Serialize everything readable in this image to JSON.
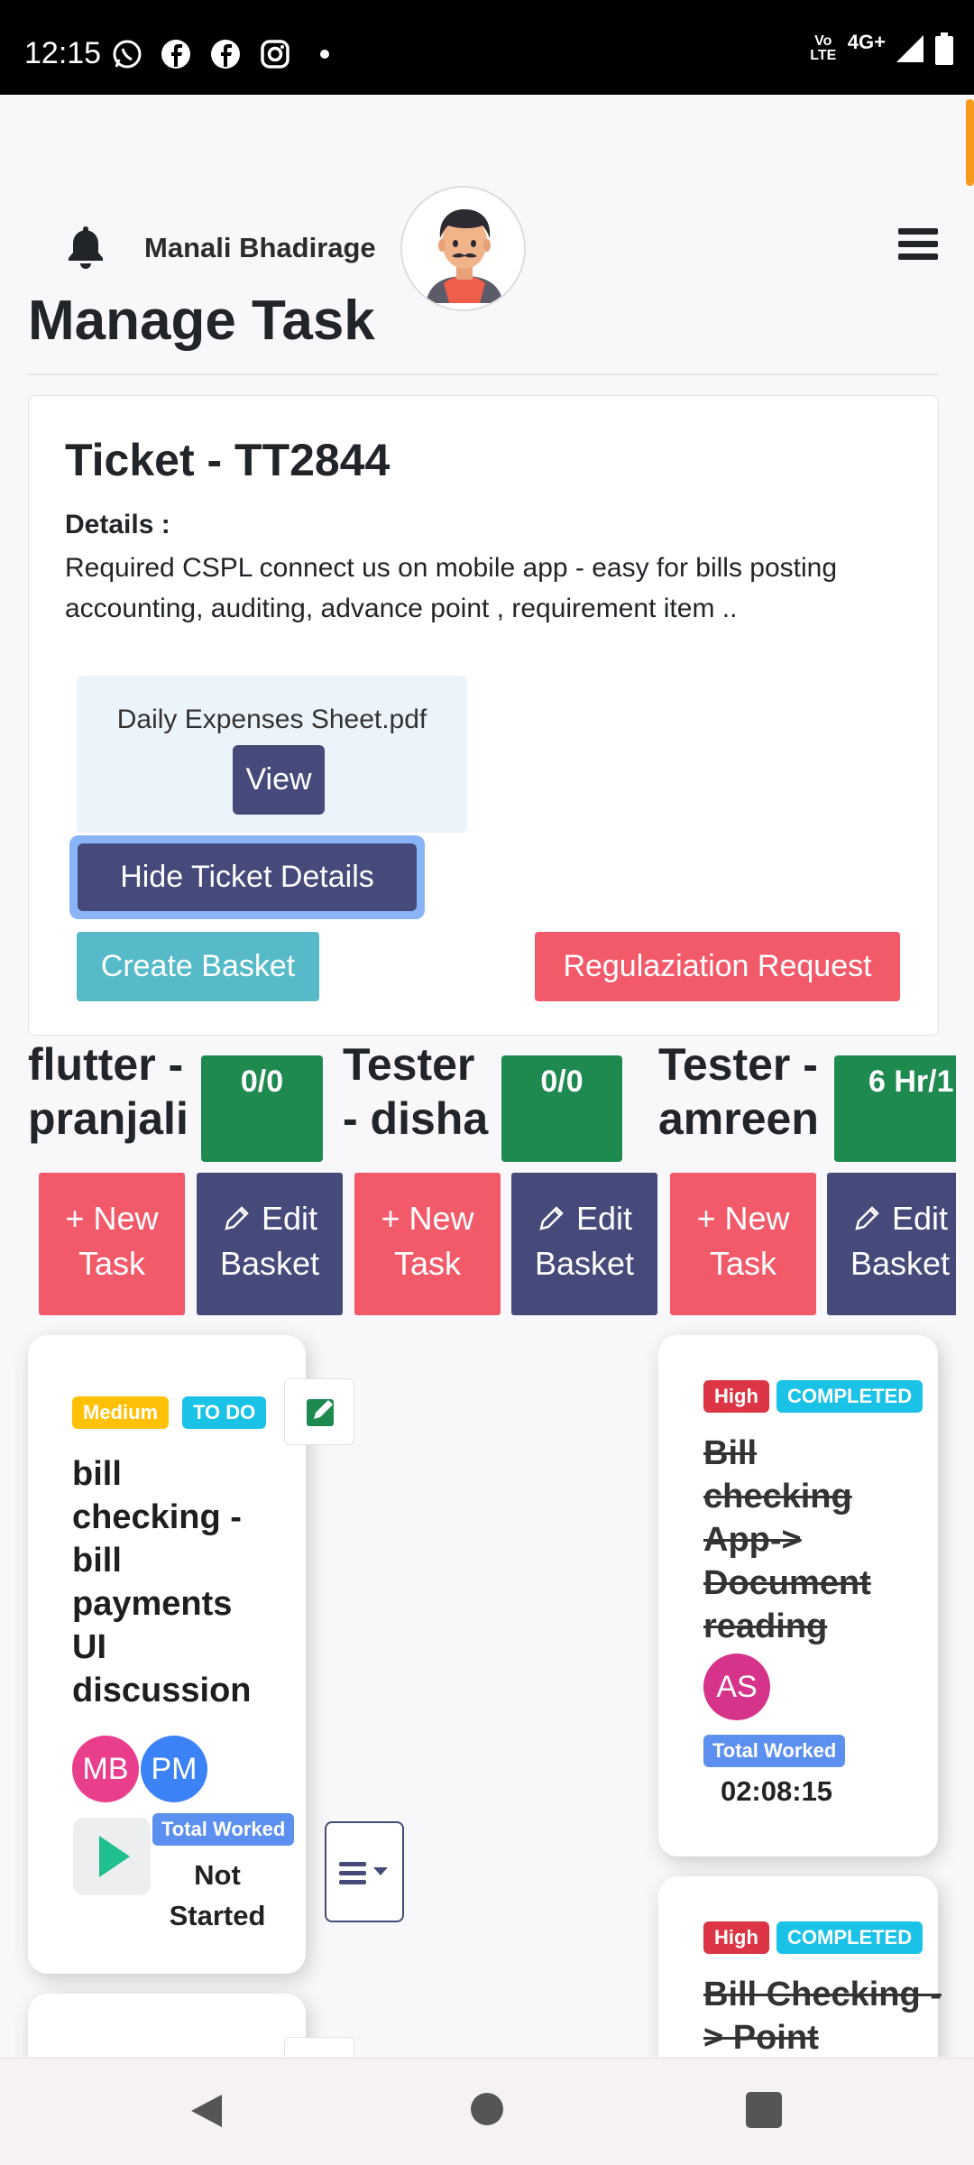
{
  "status_bar": {
    "time": "12:15",
    "volte": "Vo LTE",
    "network": "4G+"
  },
  "header": {
    "user_name": "Manali Bhadirage"
  },
  "page": {
    "title": "Manage Task"
  },
  "ticket": {
    "title": "Ticket - TT2844",
    "details_label": "Details :",
    "details_text": "Required CSPL connect us on mobile app - easy for bills posting accounting, auditing, advance point , requirement item ..",
    "attachment_name": "Daily Expenses Sheet.pdf",
    "view_label": "View",
    "hide_label": "Hide Ticket Details",
    "create_basket_label": "Create Basket",
    "regularization_label": "Regulaziation Request"
  },
  "columns": [
    {
      "heading_line1": "flutter -",
      "heading_line2": "pranjali",
      "count": "0/0",
      "new_task_line1": "+ New",
      "new_task_line2": "Task",
      "edit_line1": "Edit",
      "edit_line2": "Basket"
    },
    {
      "heading_line1": "Tester",
      "heading_line2": "- disha",
      "count": "0/0",
      "new_task_line1": "+ New",
      "new_task_line2": "Task",
      "edit_line1": "Edit",
      "edit_line2": "Basket"
    },
    {
      "heading_line1": "Tester -",
      "heading_line2": "amreen",
      "count": "6 Hr/1",
      "new_task_line1": "+ New",
      "new_task_line2": "Task",
      "edit_line1": "Edit",
      "edit_line2": "Basket"
    }
  ],
  "tasks": {
    "card1": {
      "priority": "Medium",
      "status": "TO DO",
      "title_lines": [
        "bill",
        "checking -",
        "bill",
        "payments",
        "UI",
        "discussion"
      ],
      "assignees": [
        "MB",
        "PM"
      ],
      "total_worked_label": "Total Worked",
      "total_worked_value_line1": "Not",
      "total_worked_value_line2": "Started"
    },
    "card2": {
      "priority": "High",
      "status": "COMPLETED",
      "title_lines": [
        "Bill",
        "checking",
        "App->",
        "Document",
        "reading"
      ],
      "assignees": [
        "AS"
      ],
      "total_worked_label": "Total Worked",
      "total_worked_value": "02:08:15"
    },
    "card3": {
      "priority": "High",
      "status": "COMPLETED",
      "title_lines": [
        "Bill Checking -",
        "> Point"
      ]
    }
  },
  "colors": {
    "primary_navy": "#454a7b",
    "danger_pink": "#f25a6a",
    "info_teal": "#56bac9",
    "success_green": "#1e8a50",
    "badge_medium": "#ffc107",
    "badge_cyan": "#19c2e6",
    "badge_high": "#dc3545",
    "avatar_mb": "#e83e8c",
    "avatar_pm": "#3b82f6",
    "avatar_as": "#d6338a"
  }
}
